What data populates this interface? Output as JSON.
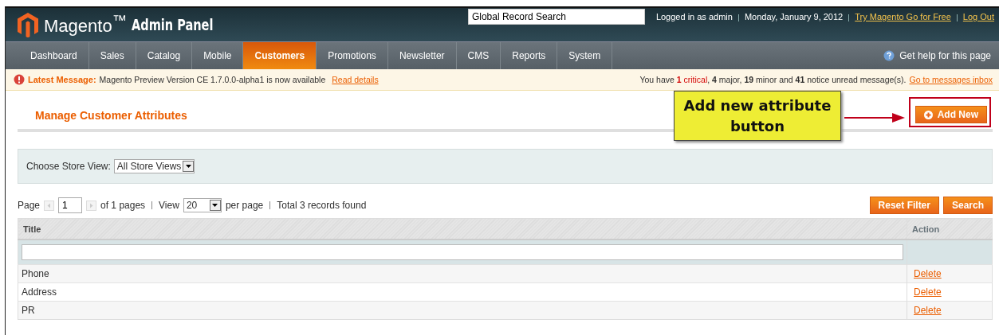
{
  "header": {
    "logo": "Magento$^{™}$",
    "title": "Admin Panel",
    "search": {
      "value": "Global Record Search"
    },
    "user_info": "Logged in as admin",
    "date": "Monday, January 9, 2012",
    "links": [
      "Try Magento Go for Free",
      "Log Out"
    ]
  },
  "nav": {
    "items": [
      {
        "label": "Dashboard",
        "selected": false
      },
      {
        "label": "Sales",
        "selected": false
      },
      {
        "label": "Catalog",
        "selected": false
      },
      {
        "label": "Mobile",
        "selected": false
      },
      {
        "label": "Customers",
        "selected": true
      },
      {
        "label": "Promotions",
        "selected": false
      },
      {
        "label": "Newsletter",
        "selected": false
      },
      {
        "label": "CMS",
        "selected": false
      },
      {
        "label": "Reports",
        "selected": false
      },
      {
        "label": "System",
        "selected": false
      }
    ],
    "help": "Get help for this page"
  },
  "message_bar": {
    "label": "Latest Message:",
    "text": "Magento Preview Version CE 1.7.0.0-alpha1 is now available",
    "link": "Read details",
    "summary": [
      {
        "text": "You have ",
        "kind": "plain"
      },
      {
        "text": "1",
        "kind": "critical-count"
      },
      {
        "text": " critical",
        "kind": "critical"
      },
      {
        "text": ", ",
        "kind": "plain"
      },
      {
        "text": "4",
        "kind": "count"
      },
      {
        "text": " major, ",
        "kind": "plain"
      },
      {
        "text": "19",
        "kind": "count"
      },
      {
        "text": " minor and ",
        "kind": "plain"
      },
      {
        "text": "41",
        "kind": "count"
      },
      {
        "text": " notice unread message(s).",
        "kind": "plain"
      }
    ],
    "inbox_link": "Go to messages inbox"
  },
  "page": {
    "title": "Manage Customer Attributes",
    "add_button": "Add New"
  },
  "callout": {
    "text": "Add new attribute button"
  },
  "store_view": {
    "label": "Choose Store View:",
    "value": "All Store Views"
  },
  "pager": {
    "page_label": "Page",
    "page": "1",
    "of_pages": "of 1 pages",
    "view_label": "View",
    "per_page": "20",
    "per_page_label": "per page",
    "total": "Total 3 records found"
  },
  "grid_buttons": [
    "Reset Filter",
    "Search"
  ],
  "table": {
    "columns": [
      "Title",
      "Action"
    ],
    "rows": [
      {
        "title": "Phone",
        "action": "Delete"
      },
      {
        "title": "Address",
        "action": "Delete"
      },
      {
        "title": "PR",
        "action": "Delete"
      }
    ]
  }
}
